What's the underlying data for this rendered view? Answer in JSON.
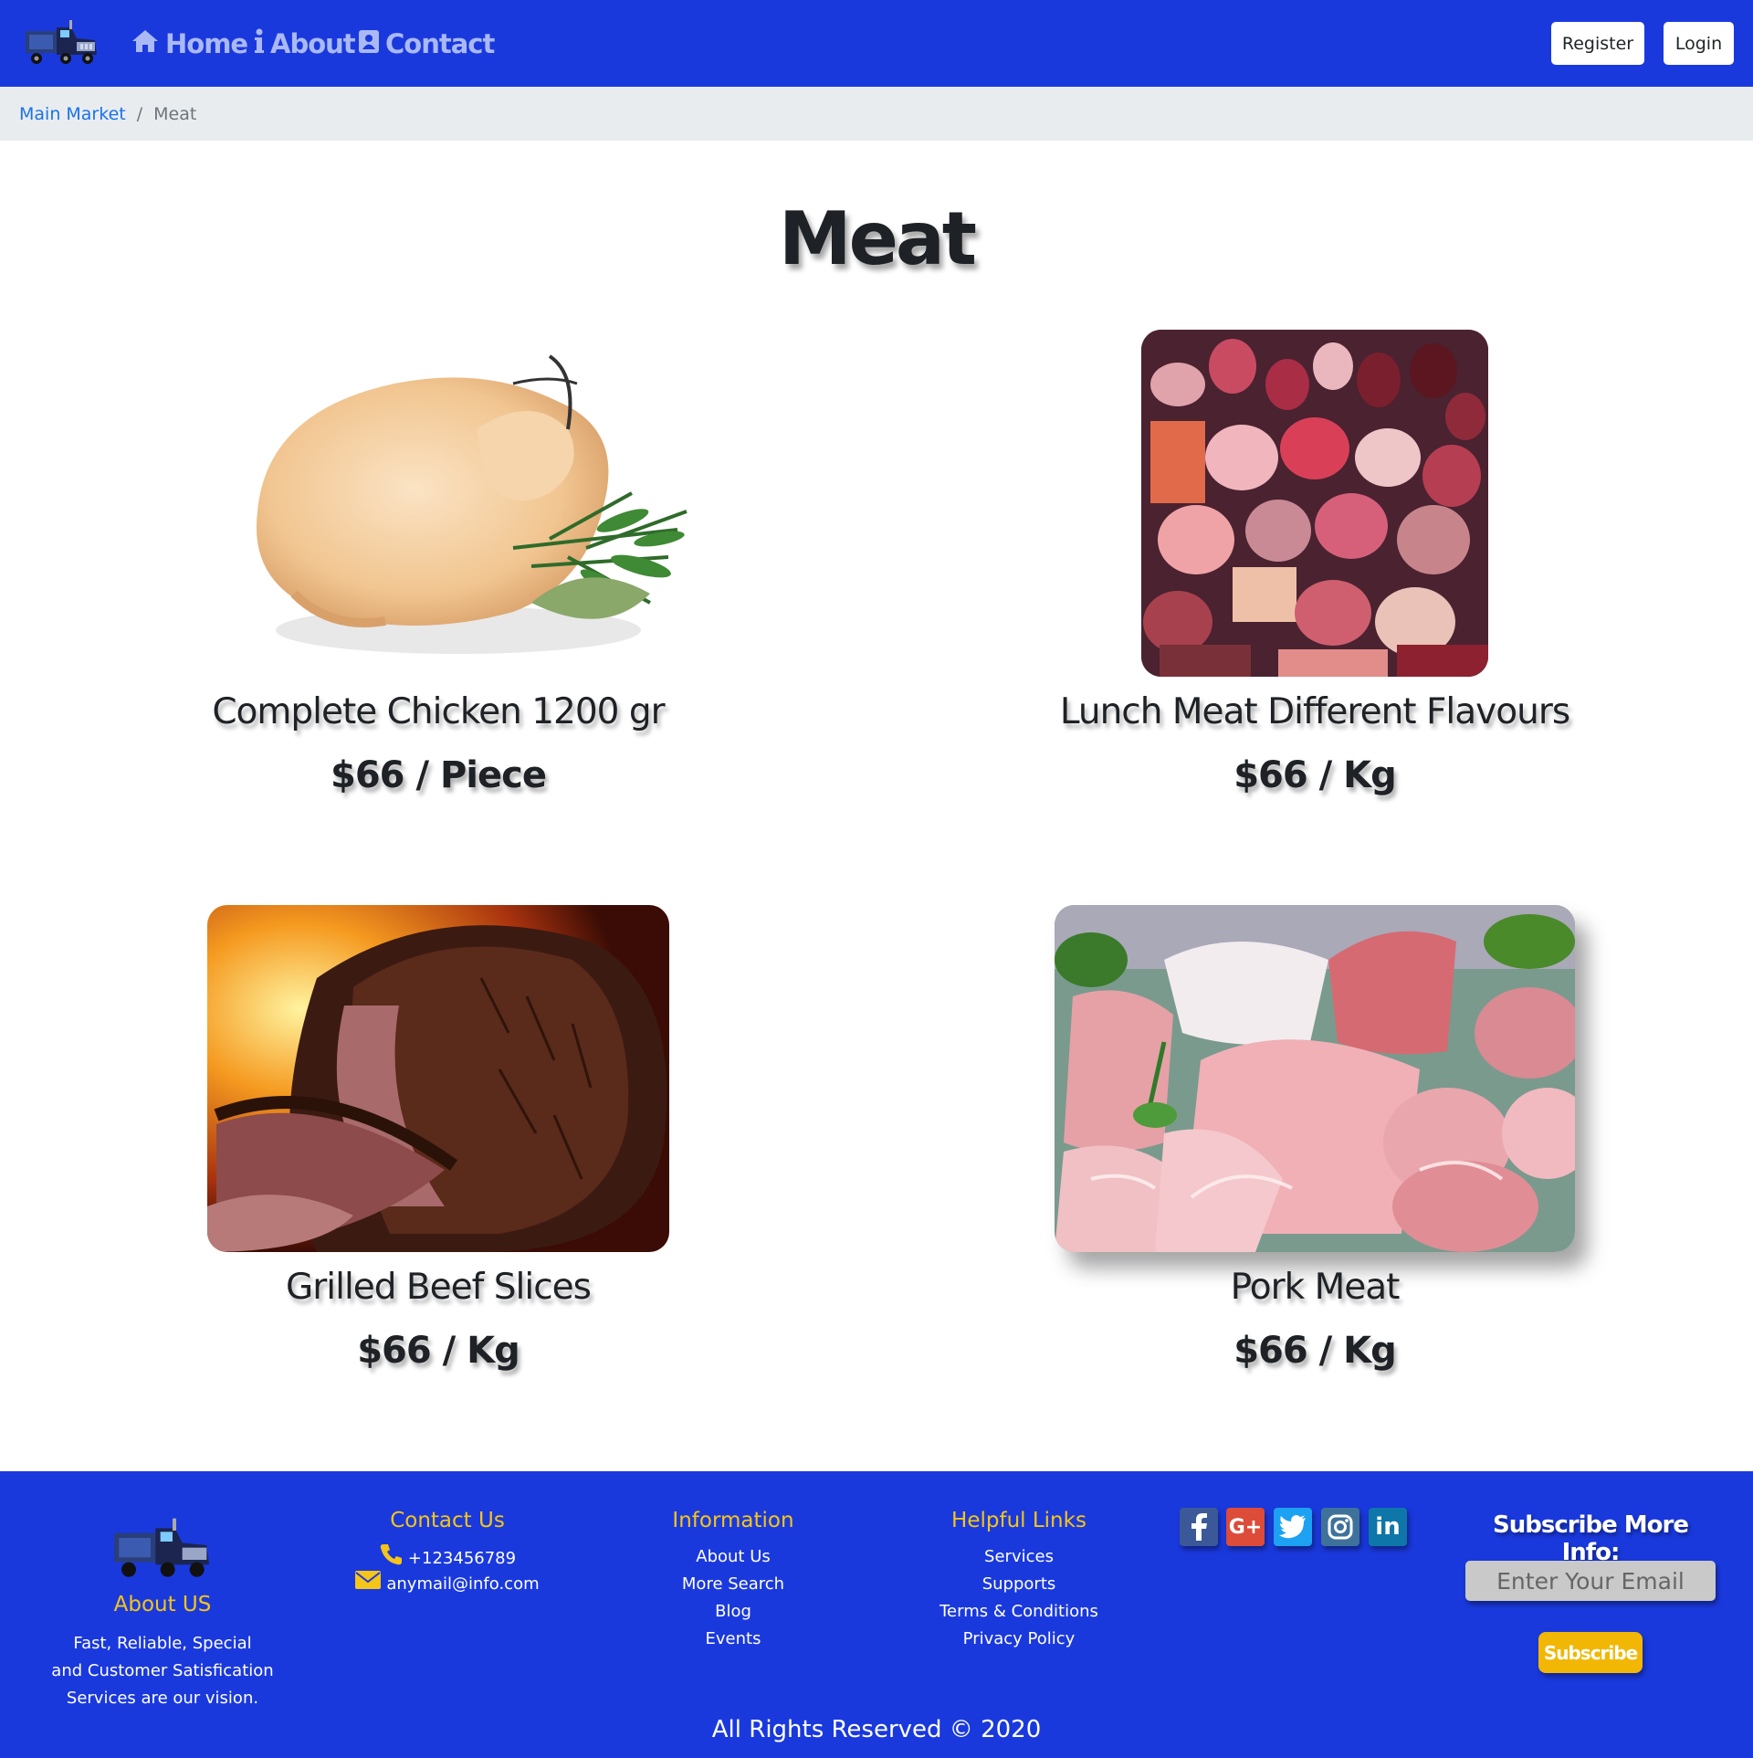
{
  "nav": {
    "home_label": "Home",
    "about_label": "About",
    "contact_label": "Contact",
    "register_label": "Register",
    "login_label": "Login"
  },
  "breadcrumb": {
    "parent": "Main Market",
    "current": "Meat"
  },
  "page": {
    "title": "Meat"
  },
  "products": [
    {
      "name": "Complete Chicken 1200 gr",
      "price": "$66 / Piece"
    },
    {
      "name": "Lunch Meat Different Flavours",
      "price": "$66 / Kg"
    },
    {
      "name": "Grilled Beef Slices",
      "price": "$66 / Kg"
    },
    {
      "name": "Pork Meat",
      "price": "$66 / Kg"
    }
  ],
  "footer": {
    "about_heading": "About US",
    "about_lines": [
      "Fast, Reliable, Special",
      "and Customer Satisfication",
      "Services are our vision."
    ],
    "contact_heading": "Contact Us",
    "phone": "+123456789",
    "email": "anymail@info.com",
    "info_heading": "Information",
    "info_links": [
      "About Us",
      "More Search",
      "Blog",
      "Events"
    ],
    "helpful_heading": "Helpful Links",
    "helpful_links": [
      "Services",
      "Supports",
      "Terms & Conditions",
      "Privacy Policy"
    ],
    "social": [
      "facebook-icon",
      "google-plus-icon",
      "twitter-icon",
      "instagram-icon",
      "linkedin-icon"
    ],
    "subscribe_title": "Subscribe More Info:",
    "email_placeholder": "Enter Your Email",
    "subscribe_label": "Subscribe",
    "copyright": "All Rights Reserved © 2020"
  },
  "colors": {
    "brand_blue": "#1a39dd",
    "footer_heading": "#f5c518",
    "subscribe_button": "#f2b705",
    "breadcrumb_bg": "#e9ecef"
  }
}
